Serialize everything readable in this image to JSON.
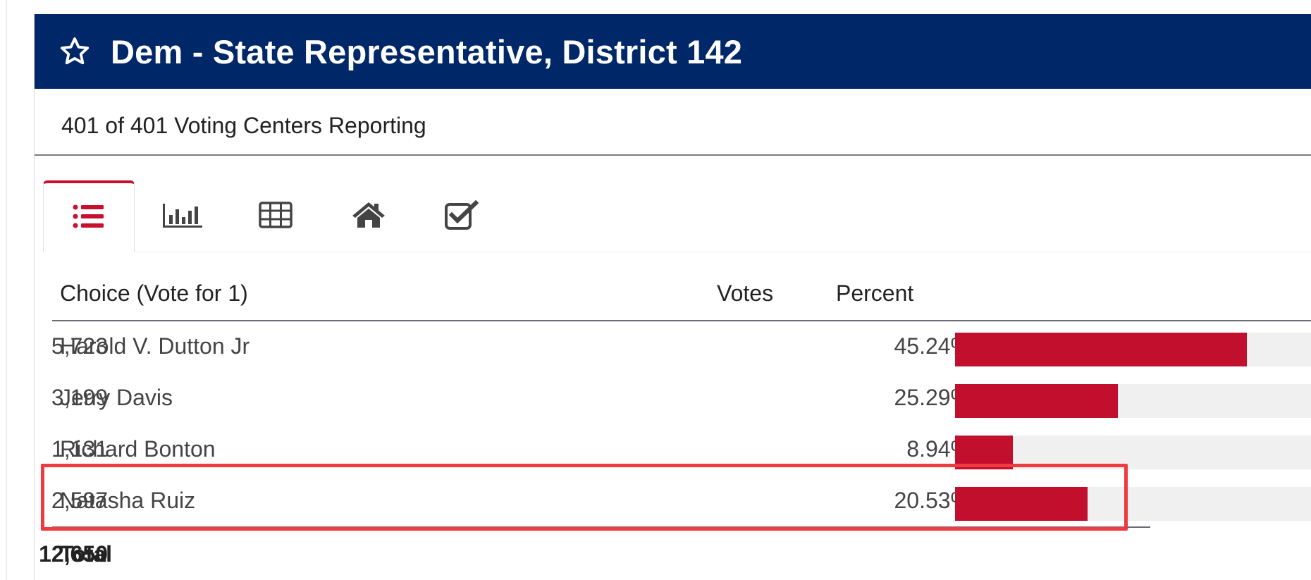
{
  "contest": {
    "title": "Dem - State Representative, District 142",
    "reporting": "401 of 401 Voting Centers Reporting"
  },
  "tabs": [
    {
      "icon": "list-icon",
      "active": true
    },
    {
      "icon": "bar-chart-icon",
      "active": false
    },
    {
      "icon": "table-icon",
      "active": false
    },
    {
      "icon": "home-icon",
      "active": false
    },
    {
      "icon": "checkbox-icon",
      "active": false
    }
  ],
  "table": {
    "headers": {
      "choice": "Choice (Vote for 1)",
      "votes": "Votes",
      "percent": "Percent"
    },
    "rows": [
      {
        "name": "Harold V. Dutton Jr",
        "votes": "5,723",
        "percent": "45.24%",
        "share": 45.24
      },
      {
        "name": "Jerry Davis",
        "votes": "3,199",
        "percent": "25.29%",
        "share": 25.29
      },
      {
        "name": "Richard Bonton",
        "votes": "1,131",
        "percent": "8.94%",
        "share": 8.94
      },
      {
        "name": "Natasha Ruiz",
        "votes": "2,597",
        "percent": "20.53%",
        "share": 20.53
      }
    ],
    "total": {
      "label": "Total",
      "votes": "12,650"
    }
  },
  "colors": {
    "header": "#002868",
    "accent": "#c8102e",
    "bar": "#c30f2e",
    "highlight": "#ef3a3f"
  }
}
